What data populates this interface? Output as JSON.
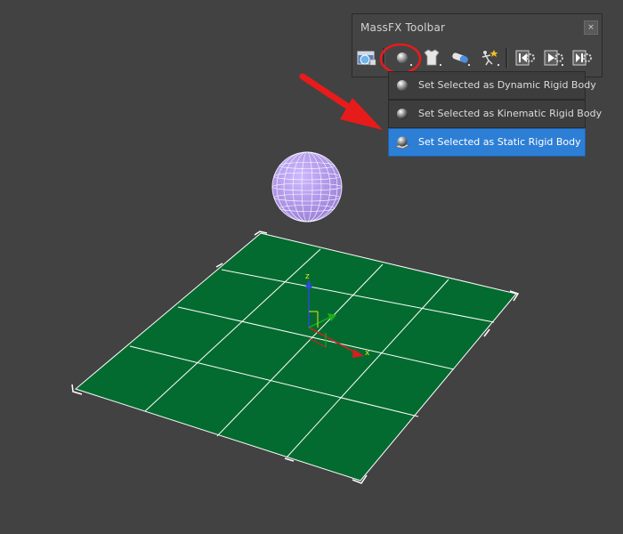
{
  "toolbar": {
    "title": "MassFX Toolbar",
    "close_glyph": "×",
    "buttons": [
      {
        "name": "world-parameters-icon"
      },
      {
        "name": "rigid-body-icon",
        "highlighted": true
      },
      {
        "name": "mcloth-icon"
      },
      {
        "name": "constraint-icon"
      },
      {
        "name": "ragdoll-icon"
      },
      {
        "name": "reset-simulation-icon"
      },
      {
        "name": "start-simulation-icon"
      },
      {
        "name": "step-simulation-icon"
      }
    ]
  },
  "dropdown": {
    "items": [
      {
        "label": "Set Selected as Dynamic Rigid Body",
        "active": false
      },
      {
        "label": "Set Selected as Kinematic Rigid Body",
        "active": false
      },
      {
        "label": "Set Selected as Static Rigid Body",
        "active": true
      }
    ]
  },
  "viewport": {
    "axis_label_z": "z",
    "axis_label_x": "x",
    "colors": {
      "background": "#424242",
      "plane": "#046b30",
      "sphere": "#a890e0",
      "annotation": "#e81b1b",
      "selection_highlight": "#2d7fd6"
    }
  }
}
